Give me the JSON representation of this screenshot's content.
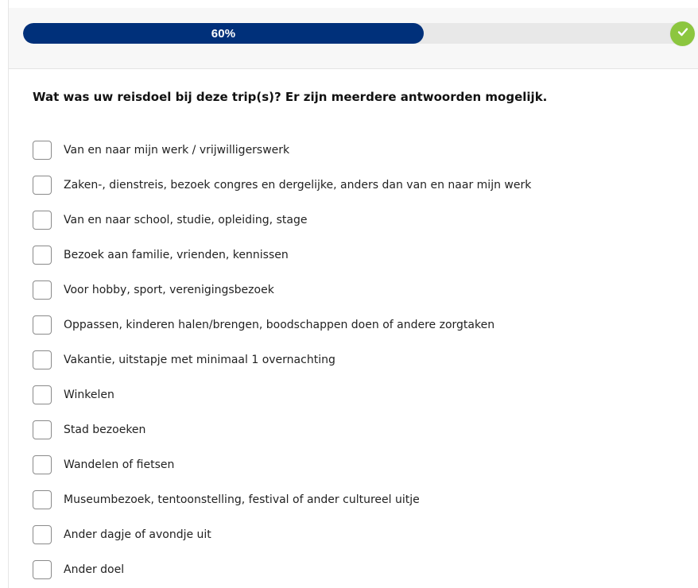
{
  "progress": {
    "label": "60%",
    "value": 0.6,
    "color_fill": "#00307a",
    "color_track": "#e8e8e8",
    "completion_icon": "checkmark-icon",
    "completion_color": "#8cc63f"
  },
  "question": {
    "title": "Wat was uw reisdoel bij deze trip(s)? Er zijn meerdere antwoorden mogelijk.",
    "options": [
      {
        "label": "Van en naar mijn werk / vrijwilligerswerk",
        "checked": false
      },
      {
        "label": "Zaken-, dienstreis, bezoek congres en dergelijke, anders dan van en naar mijn werk",
        "checked": false
      },
      {
        "label": "Van en naar school, studie, opleiding, stage",
        "checked": false
      },
      {
        "label": "Bezoek aan familie, vrienden, kennissen",
        "checked": false
      },
      {
        "label": "Voor hobby, sport, verenigingsbezoek",
        "checked": false
      },
      {
        "label": "Oppassen, kinderen halen/brengen, boodschappen doen of andere zorgtaken",
        "checked": false
      },
      {
        "label": "Vakantie, uitstapje met minimaal 1 overnachting",
        "checked": false
      },
      {
        "label": "Winkelen",
        "checked": false
      },
      {
        "label": "Stad bezoeken",
        "checked": false
      },
      {
        "label": "Wandelen of fietsen",
        "checked": false
      },
      {
        "label": "Museumbezoek, tentoonstelling, festival of ander cultureel uitje",
        "checked": false
      },
      {
        "label": "Ander dagje of avondje uit",
        "checked": false
      },
      {
        "label": "Ander doel",
        "checked": false
      }
    ]
  }
}
